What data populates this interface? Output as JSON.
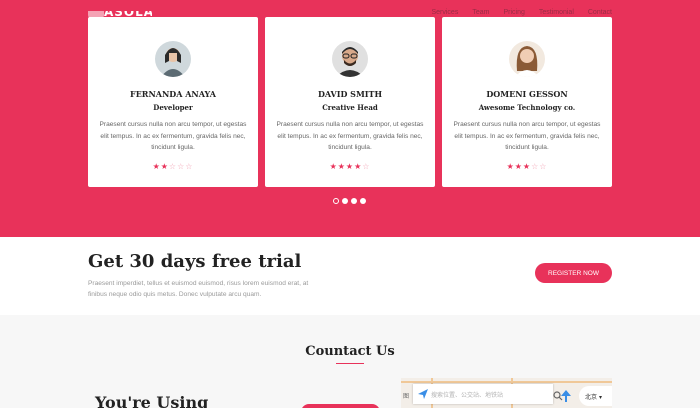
{
  "header": {
    "logo_text": "ASOLAI",
    "nav": [
      "Services",
      "Team",
      "Pricing",
      "Testimonial",
      "Contact"
    ]
  },
  "testimonials": {
    "cards": [
      {
        "name": "FERNANDA ANAYA",
        "role": "Developer",
        "quote": "Praesent cursus nulla non arcu tempor, ut egestas elit tempus. In ac ex fermentum, gravida felis nec, tincidunt ligula.",
        "rating": 2,
        "rating_max": 5,
        "avatar": "avatar-woman-icon"
      },
      {
        "name": "DAVID SMITH",
        "role": "Creative Head",
        "quote": "Praesent cursus nulla non arcu tempor, ut egestas elit tempus. In ac ex fermentum, gravida felis nec, tincidunt ligula.",
        "rating": 4,
        "rating_max": 5,
        "avatar": "avatar-man-icon"
      },
      {
        "name": "DOMENI GESSON",
        "role": "Awesome Technology co.",
        "quote": "Praesent cursus nulla non arcu tempor, ut egestas elit tempus. In ac ex fermentum, gravida felis nec, tincidunt ligula.",
        "rating": 3,
        "rating_max": 5,
        "avatar": "avatar-woman-2-icon"
      }
    ],
    "carousel_pages": 4,
    "carousel_active": 1
  },
  "trial": {
    "title": "Get 30 days free trial",
    "text": "Praesent imperdiet, tellus et euismod euismod, risus lorem euismod erat, at finibus neque odio quis metus. Donec vulputate arcu quam.",
    "button": "REGISTER NOW"
  },
  "contact": {
    "title": "Countact Us",
    "subtitle": "You're Using",
    "map": {
      "search_placeholder": "搜索位置、公交站、地铁站",
      "city": "北京",
      "side_label": "图"
    }
  },
  "colors": {
    "brand": "#e8325a",
    "star_off": "#f3a7b8"
  }
}
